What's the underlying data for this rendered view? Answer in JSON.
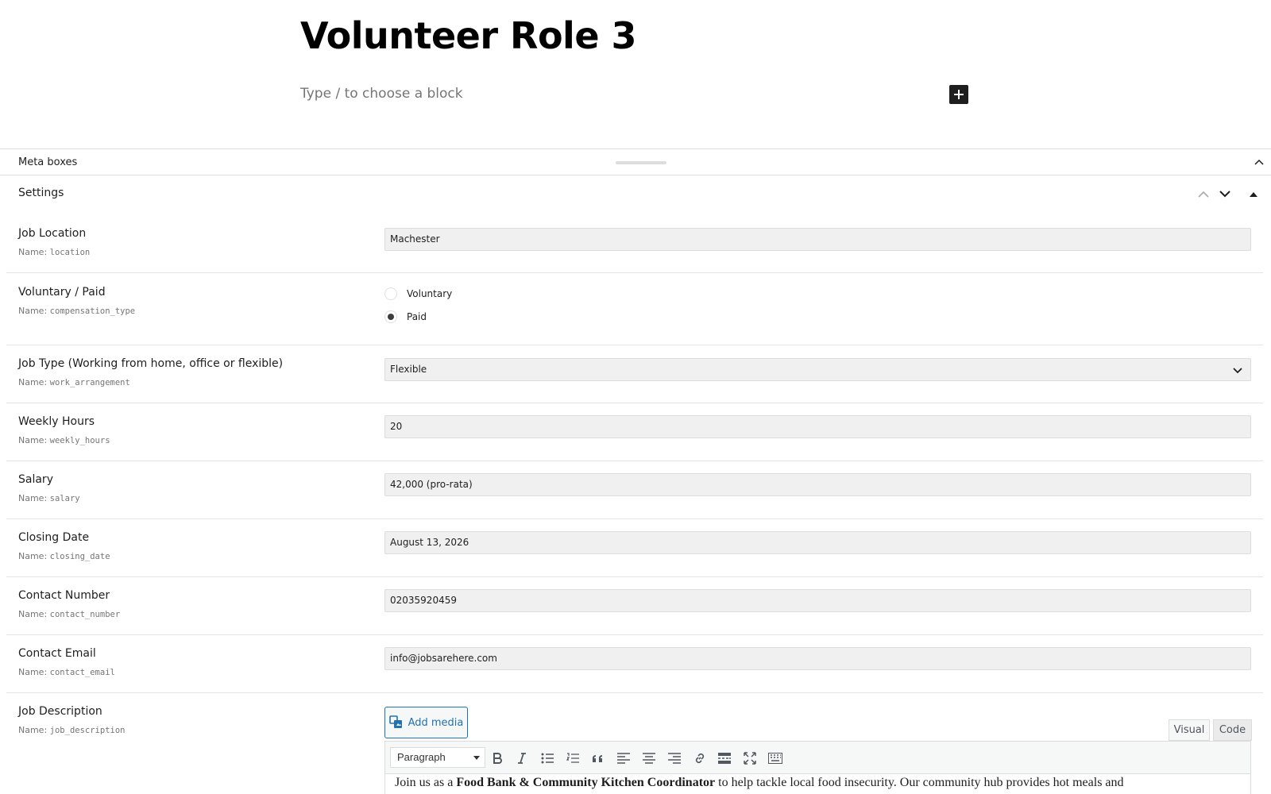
{
  "post": {
    "title": "Volunteer Role 3",
    "block_placeholder": "Type / to choose a block"
  },
  "metabox": {
    "title": "Meta boxes"
  },
  "settings": {
    "title": "Settings",
    "fields": {
      "location": {
        "label": "Job Location",
        "name_prefix": "Name: ",
        "name": "location",
        "value": "Machester"
      },
      "compensation_type": {
        "label": "Voluntary / Paid",
        "name_prefix": "Name: ",
        "name": "compensation_type",
        "options": [
          "Voluntary",
          "Paid"
        ],
        "selected": "Paid"
      },
      "work_arrangement": {
        "label": "Job Type (Working from home, office or flexible)",
        "name_prefix": "Name: ",
        "name": "work_arrangement",
        "value": "Flexible"
      },
      "weekly_hours": {
        "label": "Weekly Hours",
        "name_prefix": "Name: ",
        "name": "weekly_hours",
        "value": "20"
      },
      "salary": {
        "label": "Salary",
        "name_prefix": "Name: ",
        "name": "salary",
        "value": "42,000 (pro-rata)"
      },
      "closing_date": {
        "label": "Closing Date",
        "name_prefix": "Name: ",
        "name": "closing_date",
        "value": "August 13, 2026"
      },
      "contact_number": {
        "label": "Contact Number",
        "name_prefix": "Name: ",
        "name": "contact_number",
        "value": "02035920459"
      },
      "contact_email": {
        "label": "Contact Email",
        "name_prefix": "Name: ",
        "name": "contact_email",
        "value": "info@jobsarehere.com"
      },
      "job_description": {
        "label": "Job Description",
        "name_prefix": "Name: ",
        "name": "job_description"
      }
    }
  },
  "editor": {
    "add_media": "Add media",
    "tab_visual": "Visual",
    "tab_code": "Code",
    "format": "Paragraph",
    "content_start": "Join us as a ",
    "content_bold": "Food Bank & Community Kitchen Coordinator",
    "content_end": " to help tackle local food insecurity. Our community hub provides hot meals and"
  },
  "colors": {
    "accent": "#2271b1",
    "input_bg": "#f0f0f0"
  }
}
